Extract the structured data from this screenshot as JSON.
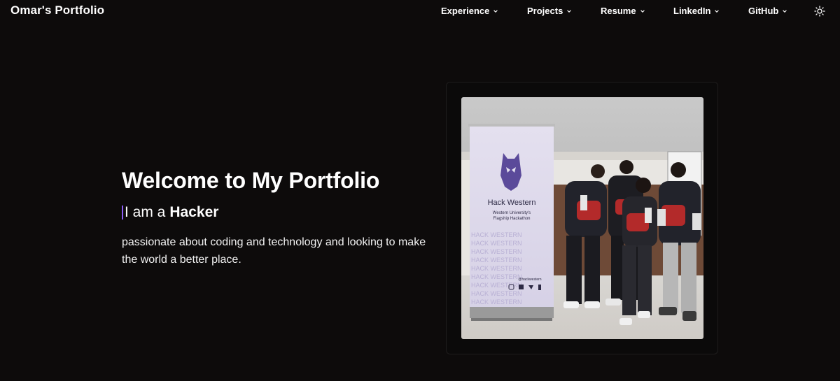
{
  "nav": {
    "brand": "Omar's Portfolio",
    "items": [
      {
        "label": "Experience"
      },
      {
        "label": "Projects"
      },
      {
        "label": "Resume"
      },
      {
        "label": "LinkedIn"
      },
      {
        "label": "GitHub"
      }
    ],
    "theme_icon": "sun-icon"
  },
  "hero": {
    "title": "Welcome to My Portfolio",
    "typed_prefix": "I am a",
    "typed_word": "Hacker",
    "tagline": "passionate about coding and technology and looking to make the world a better place."
  },
  "photo": {
    "banner_title": "Hack Western",
    "banner_subtitle_1": "Western University's",
    "banner_subtitle_2": "Flagship Hackathon",
    "banner_handle": "@hackwestern",
    "banner_repeat": "HACK WESTERN"
  },
  "colors": {
    "background": "#0d0b0b",
    "accent_cursor": "#8b5cf6",
    "banner_purple": "#5b4a9a"
  }
}
